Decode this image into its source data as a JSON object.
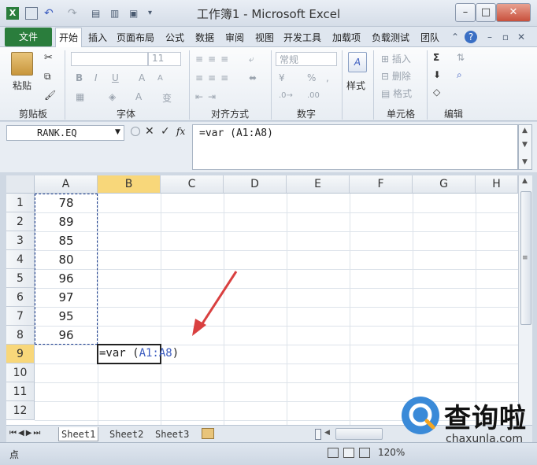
{
  "window": {
    "title": "工作簿1 - Microsoft Excel",
    "controls": [
      "–",
      "□",
      "✕"
    ]
  },
  "tabs": [
    {
      "label": "文件"
    },
    {
      "label": "开始"
    },
    {
      "label": "插入"
    },
    {
      "label": "页面布局"
    },
    {
      "label": "公式"
    },
    {
      "label": "数据"
    },
    {
      "label": "审阅"
    },
    {
      "label": "视图"
    },
    {
      "label": "开发工具"
    },
    {
      "label": "加载项"
    },
    {
      "label": "负载测试"
    },
    {
      "label": "团队"
    }
  ],
  "ribbon": {
    "clipboard": {
      "paste": "粘贴",
      "label": "剪贴板"
    },
    "font": {
      "size": "11",
      "bold": "B",
      "italic": "I",
      "underline": "U",
      "label": "字体",
      "grow": "A",
      "shrink": "A",
      "color_a": "A",
      "wen": "变"
    },
    "alignment": {
      "label": "对齐方式"
    },
    "number": {
      "format": "常规",
      "percent": "%",
      "comma": ",",
      "label": "数字"
    },
    "styles": {
      "label": "样式"
    },
    "cells": {
      "insert": "插入",
      "delete": "删除",
      "format": "格式",
      "label": "单元格"
    },
    "editing": {
      "sigma": "Σ",
      "label": "编辑"
    }
  },
  "formula_bar": {
    "name_box": "RANK.EQ",
    "fx": "fx",
    "formula": "=var (A1:A8)"
  },
  "grid": {
    "columns": [
      "A",
      "B",
      "C",
      "D",
      "E",
      "F",
      "G",
      "H"
    ],
    "rows": [
      "1",
      "2",
      "3",
      "4",
      "5",
      "6",
      "7",
      "8",
      "9",
      "10",
      "11",
      "12"
    ],
    "a_values": [
      "78",
      "89",
      "85",
      "80",
      "96",
      "97",
      "95",
      "96"
    ],
    "edit_prefix": "=var (",
    "edit_ref": "A1:A8",
    "edit_suffix": ")"
  },
  "sheets": [
    "Sheet1",
    "Sheet2",
    "Sheet3"
  ],
  "status": {
    "mode": "点",
    "zoom": "120%"
  },
  "watermark": {
    "text": "查询啦",
    "url": "chaxunla.com"
  },
  "colors": {
    "accent": "#2a7d3c",
    "active_header": "#f8d77a",
    "ref_blue": "#3a5bbf",
    "arrow": "#d94040"
  }
}
